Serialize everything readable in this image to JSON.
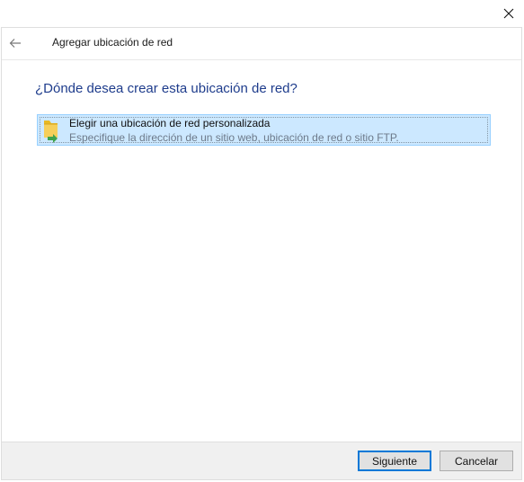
{
  "window": {
    "close_icon": "close-icon"
  },
  "header": {
    "back_icon": "back-arrow-icon",
    "title": "Agregar ubicación de red"
  },
  "main": {
    "heading": "¿Dónde desea crear esta ubicación de red?",
    "options": [
      {
        "icon": "network-folder-icon",
        "title": "Elegir una ubicación de red personalizada",
        "description": "Especifique la dirección de un sitio web, ubicación de red o sitio FTP.",
        "selected": true
      }
    ]
  },
  "footer": {
    "next_label": "Siguiente",
    "cancel_label": "Cancelar"
  },
  "colors": {
    "heading": "#1e3c8c",
    "selection_bg": "#cce8ff",
    "selection_border": "#99d1ff",
    "primary_border": "#0078d7",
    "footer_bg": "#f0f0f0"
  }
}
